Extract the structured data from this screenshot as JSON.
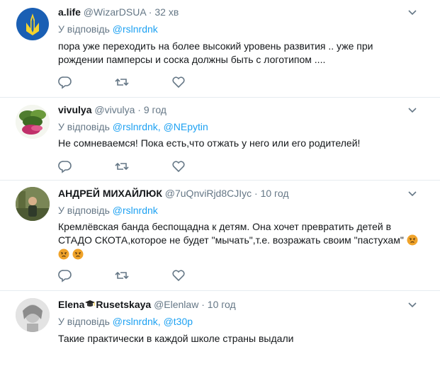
{
  "reply_prefix": "У відповідь",
  "tweets": [
    {
      "name": "a.life",
      "handle": "@WizarDSUA",
      "dot": "·",
      "time": "32 хв",
      "reply_to": [
        "@rslnrdnk"
      ],
      "text_lines": [
        "пора уже переходить на более высокий уровень развития .. уже при",
        "рождении памперсы и соска  должны быть с логотипом ...."
      ]
    },
    {
      "name": "vivulya",
      "handle": "@vivulya",
      "dot": "·",
      "time": "9 год",
      "reply_to": [
        "@rslnrdnk",
        "@NEpytin"
      ],
      "reply_sep": ", ",
      "text_lines": [
        "Не сомневаемся! Пока есть,что отжать у него или его родителей!"
      ]
    },
    {
      "name": "АНДРЕЙ МИХАЙЛЮК",
      "handle": "@7uQnviRjd8CJIyc",
      "dot": "·",
      "time": "10 год",
      "reply_to": [
        "@rslnrdnk"
      ],
      "text_lines": [
        "Кремлёвская банда беспощадна к детям. Она хочет превратить детей в",
        "СТАДО  СКОТА,которое не будет \"мычать\",т.е. возражать своим \"пастухам\""
      ]
    },
    {
      "name_part1": "Elena",
      "name_part2": "Rusetskaya",
      "handle": "@Elenlaw",
      "dot": "·",
      "time": "10 год",
      "reply_to": [
        "@rslnrdnk",
        "@t30p"
      ],
      "reply_sep": ", ",
      "text_lines": [
        "Такие практически в каждой школе страны выдали"
      ]
    }
  ],
  "colors": {
    "link": "#1da1f2",
    "secondary": "#657786",
    "separator": "#e6ecf0",
    "icon": "#657786"
  },
  "icons": [
    "chevron-down-icon",
    "reply-icon",
    "retweet-icon",
    "like-icon",
    "angry-face-emoji",
    "graduation-cap-emoji"
  ]
}
